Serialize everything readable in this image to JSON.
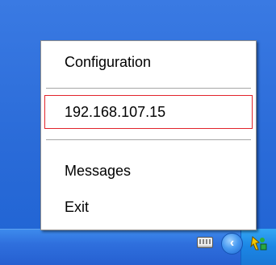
{
  "menu": {
    "items": [
      {
        "label": "Configuration"
      },
      {
        "label": "192.168.107.15"
      },
      {
        "label": "Messages"
      },
      {
        "label": "Exit"
      }
    ]
  },
  "taskbar": {
    "tray": {
      "chevron_symbol": "‹",
      "icons": [
        "keyboard-icon",
        "show-hidden-icons-chevron",
        "app-tray-icon"
      ]
    }
  },
  "colors": {
    "desktop_blue": "#2A6BD8",
    "menu_bg": "#FFFFFF",
    "highlight_border": "#E2242B",
    "separator": "#A6A6A6"
  }
}
